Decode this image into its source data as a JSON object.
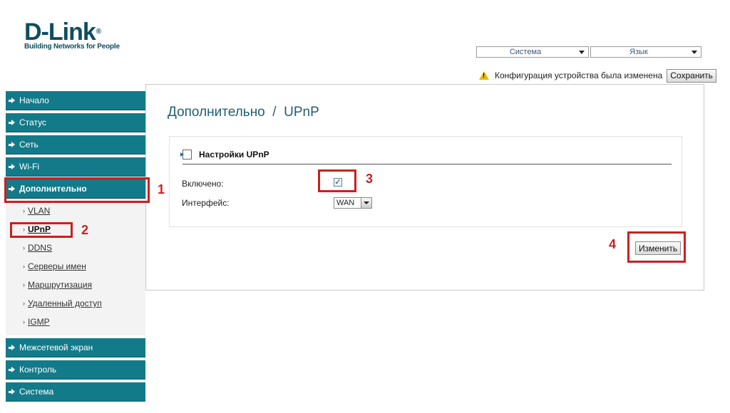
{
  "brand": {
    "logo_text": "D-Link",
    "registered_mark": "®",
    "tagline": "Building Networks for People"
  },
  "header": {
    "system_select": "Система",
    "language_select": "Язык",
    "notice_text": "Конфигурация устройства была изменена",
    "save_label": "Сохранить"
  },
  "sidebar": {
    "items": [
      {
        "label": "Начало"
      },
      {
        "label": "Статус"
      },
      {
        "label": "Сеть"
      },
      {
        "label": "Wi-Fi"
      },
      {
        "label": "Дополнительно"
      },
      {
        "label": "Межсетевой экран"
      },
      {
        "label": "Контроль"
      },
      {
        "label": "Система"
      }
    ],
    "submenu": [
      {
        "label": "VLAN"
      },
      {
        "label": "UPnP"
      },
      {
        "label": "DDNS"
      },
      {
        "label": "Серверы имен"
      },
      {
        "label": "Маршрутизация"
      },
      {
        "label": "Удаленный доступ"
      },
      {
        "label": "IGMP"
      }
    ]
  },
  "main": {
    "page_title": "Дополнительно  /  UPnP",
    "panel_title": "Настройки UPnP",
    "enabled_label": "Включено:",
    "enabled_checked": true,
    "checkbox_mark": "✓",
    "interface_label": "Интерфейс:",
    "interface_value": "WAN",
    "change_label": "Изменить"
  },
  "annotations": {
    "n1": "1",
    "n2": "2",
    "n3": "3",
    "n4": "4",
    "color": "#cc1f1f"
  },
  "colors": {
    "nav_bg": "#137a8a",
    "brand": "#0e4d62",
    "title": "#1f5f72"
  }
}
